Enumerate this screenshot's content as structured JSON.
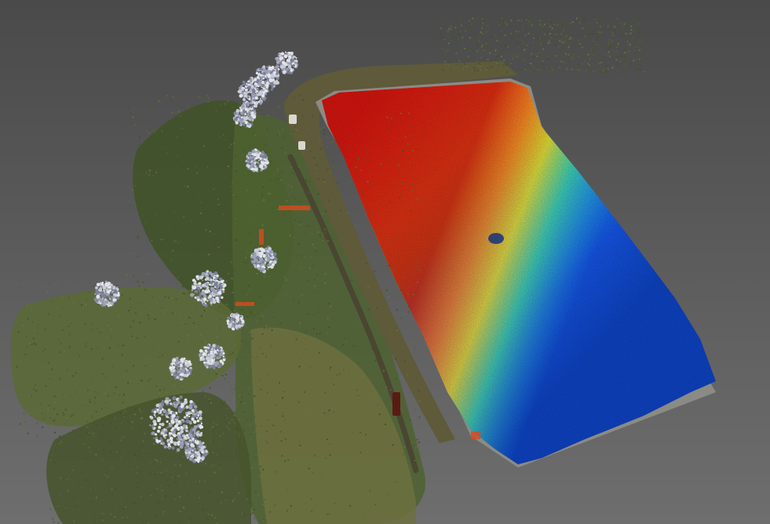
{
  "scene": {
    "background": {
      "top": "#4a4a4a",
      "bottom": "#6e6e6e"
    },
    "land_colors": [
      "#3f5226",
      "#4e6230",
      "#5b6a35",
      "#46542c",
      "#6d7040"
    ],
    "tree_colors": [
      "#c9ccd6",
      "#9a9fb3",
      "#e3e4ea",
      "#7c8098"
    ],
    "embankment_color": "#5e5a3a",
    "wall_color": "#8b8b85",
    "water_depth_ramp": [
      "#c8140e",
      "#e7501a",
      "#f0c020",
      "#8ed234",
      "#27c0a8",
      "#1c8ee0",
      "#1450d8",
      "#0d3fb8"
    ],
    "marker_color": "#d94a1e"
  }
}
